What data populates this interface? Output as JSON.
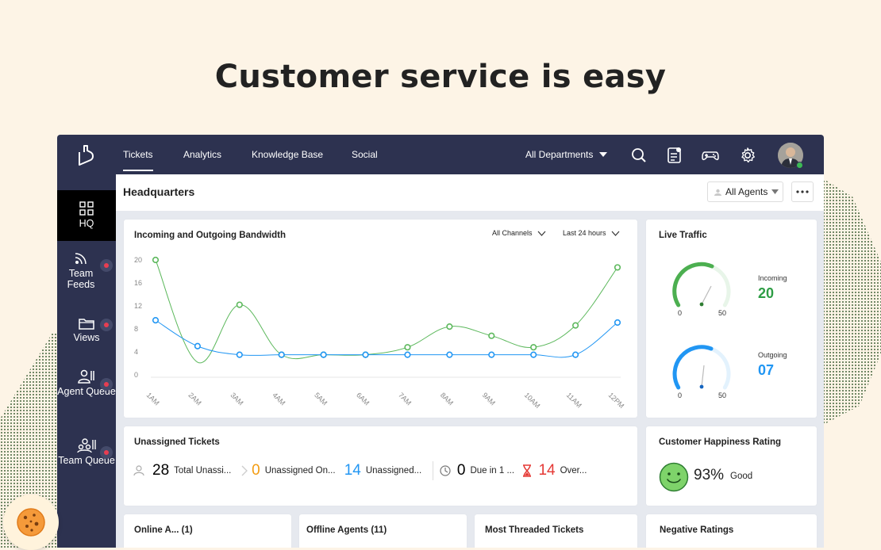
{
  "headline": "Customer service is easy",
  "colors": {
    "navy": "#2d3250",
    "green": "#5cb85c",
    "blue": "#2196f3",
    "orange": "#f39c12",
    "red": "#e53935"
  },
  "topbar": {
    "nav": [
      "Tickets",
      "Analytics",
      "Knowledge Base",
      "Social"
    ],
    "active": "Tickets",
    "department": "All Departments",
    "icons": [
      "search-icon",
      "notes-icon",
      "gamepad-icon",
      "gear-icon"
    ]
  },
  "sidebar": {
    "items": [
      {
        "label": "HQ",
        "icon": "grid-icon"
      },
      {
        "label": "Team Feeds",
        "icon": "feeds-icon"
      },
      {
        "label": "Views",
        "icon": "folder-icon"
      },
      {
        "label": "Agent Queue",
        "icon": "agent-icon"
      },
      {
        "label": "Team Queue",
        "icon": "team-icon"
      }
    ]
  },
  "header": {
    "title": "Headquarters",
    "agents_filter": "All Agents"
  },
  "bandwidth": {
    "title": "Incoming and Outgoing Bandwidth",
    "channels": "All Channels",
    "period": "Last 24 hours"
  },
  "chart_data": {
    "type": "line",
    "categories": [
      "1AM",
      "2AM",
      "3AM",
      "4AM",
      "5AM",
      "6AM",
      "7AM",
      "8AM",
      "9AM",
      "10AM",
      "11AM",
      "12PM"
    ],
    "yticks": [
      0,
      4,
      8,
      12,
      16,
      20
    ],
    "ylim": [
      0,
      20
    ],
    "series": [
      {
        "color": "#5cb85c",
        "values": [
          20,
          null,
          12.2,
          3.5,
          3.5,
          3.5,
          4.8,
          8.4,
          6.8,
          4.8,
          8.6,
          18.7
        ]
      },
      {
        "color": "#2196f3",
        "values": [
          9.5,
          5,
          3.5,
          3.5,
          3.5,
          3.5,
          3.5,
          3.5,
          3.5,
          3.5,
          3.5,
          9.1
        ]
      }
    ],
    "green_dip_at_2am": 2.2,
    "grid": false
  },
  "live_traffic": {
    "title": "Live Traffic",
    "incoming": {
      "label": "Incoming",
      "value": "20",
      "min": "0",
      "max": "50"
    },
    "outgoing": {
      "label": "Outgoing",
      "value": "07",
      "min": "0",
      "max": "50"
    }
  },
  "unassigned": {
    "title": "Unassigned Tickets",
    "stats": [
      {
        "value": "28",
        "label": "Total Unassi...",
        "color": "#222222",
        "icon": "user-icon"
      },
      {
        "value": "0",
        "label": "Unassigned On...",
        "color": "#f39c12",
        "icon": "chevron-right-icon"
      },
      {
        "value": "14",
        "label": "Unassigned...",
        "color": "#2196f3",
        "icon": ""
      },
      {
        "value": "0",
        "label": "Due in 1 ...",
        "color": "#222222",
        "icon": "clock-icon"
      },
      {
        "value": "14",
        "label": "Over...",
        "color": "#e53935",
        "icon": "hourglass-icon"
      }
    ]
  },
  "happiness": {
    "title": "Customer Happiness Rating",
    "percent": "93%",
    "label": "Good"
  },
  "bottom_cards": [
    {
      "title": "Online A... (1)"
    },
    {
      "title": "Offline Agents (11)"
    },
    {
      "title": "Most Threaded Tickets"
    },
    {
      "title": "Negative Ratings"
    }
  ]
}
